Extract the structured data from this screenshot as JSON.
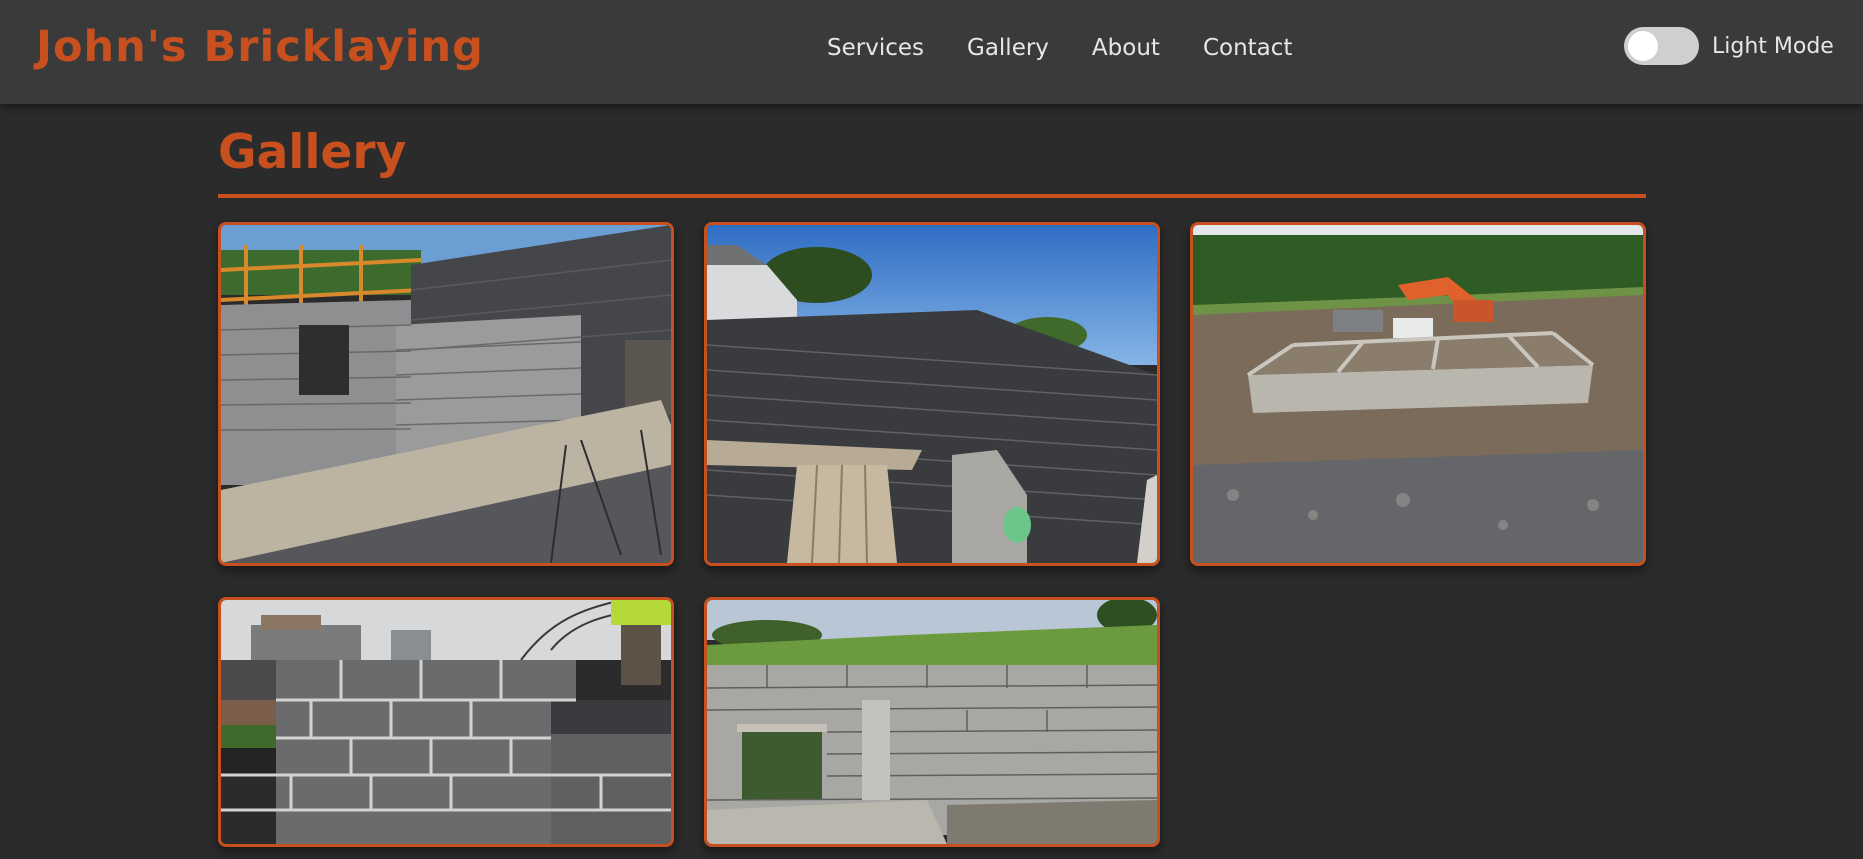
{
  "header": {
    "brand": "John's Bricklaying",
    "nav": [
      "Services",
      "Gallery",
      "About",
      "Contact"
    ],
    "theme_toggle_label": "Light Mode"
  },
  "main": {
    "title": "Gallery"
  },
  "colors": {
    "accent": "#c8501e",
    "background": "#2b2b2b",
    "header": "#3a3a3a"
  }
}
